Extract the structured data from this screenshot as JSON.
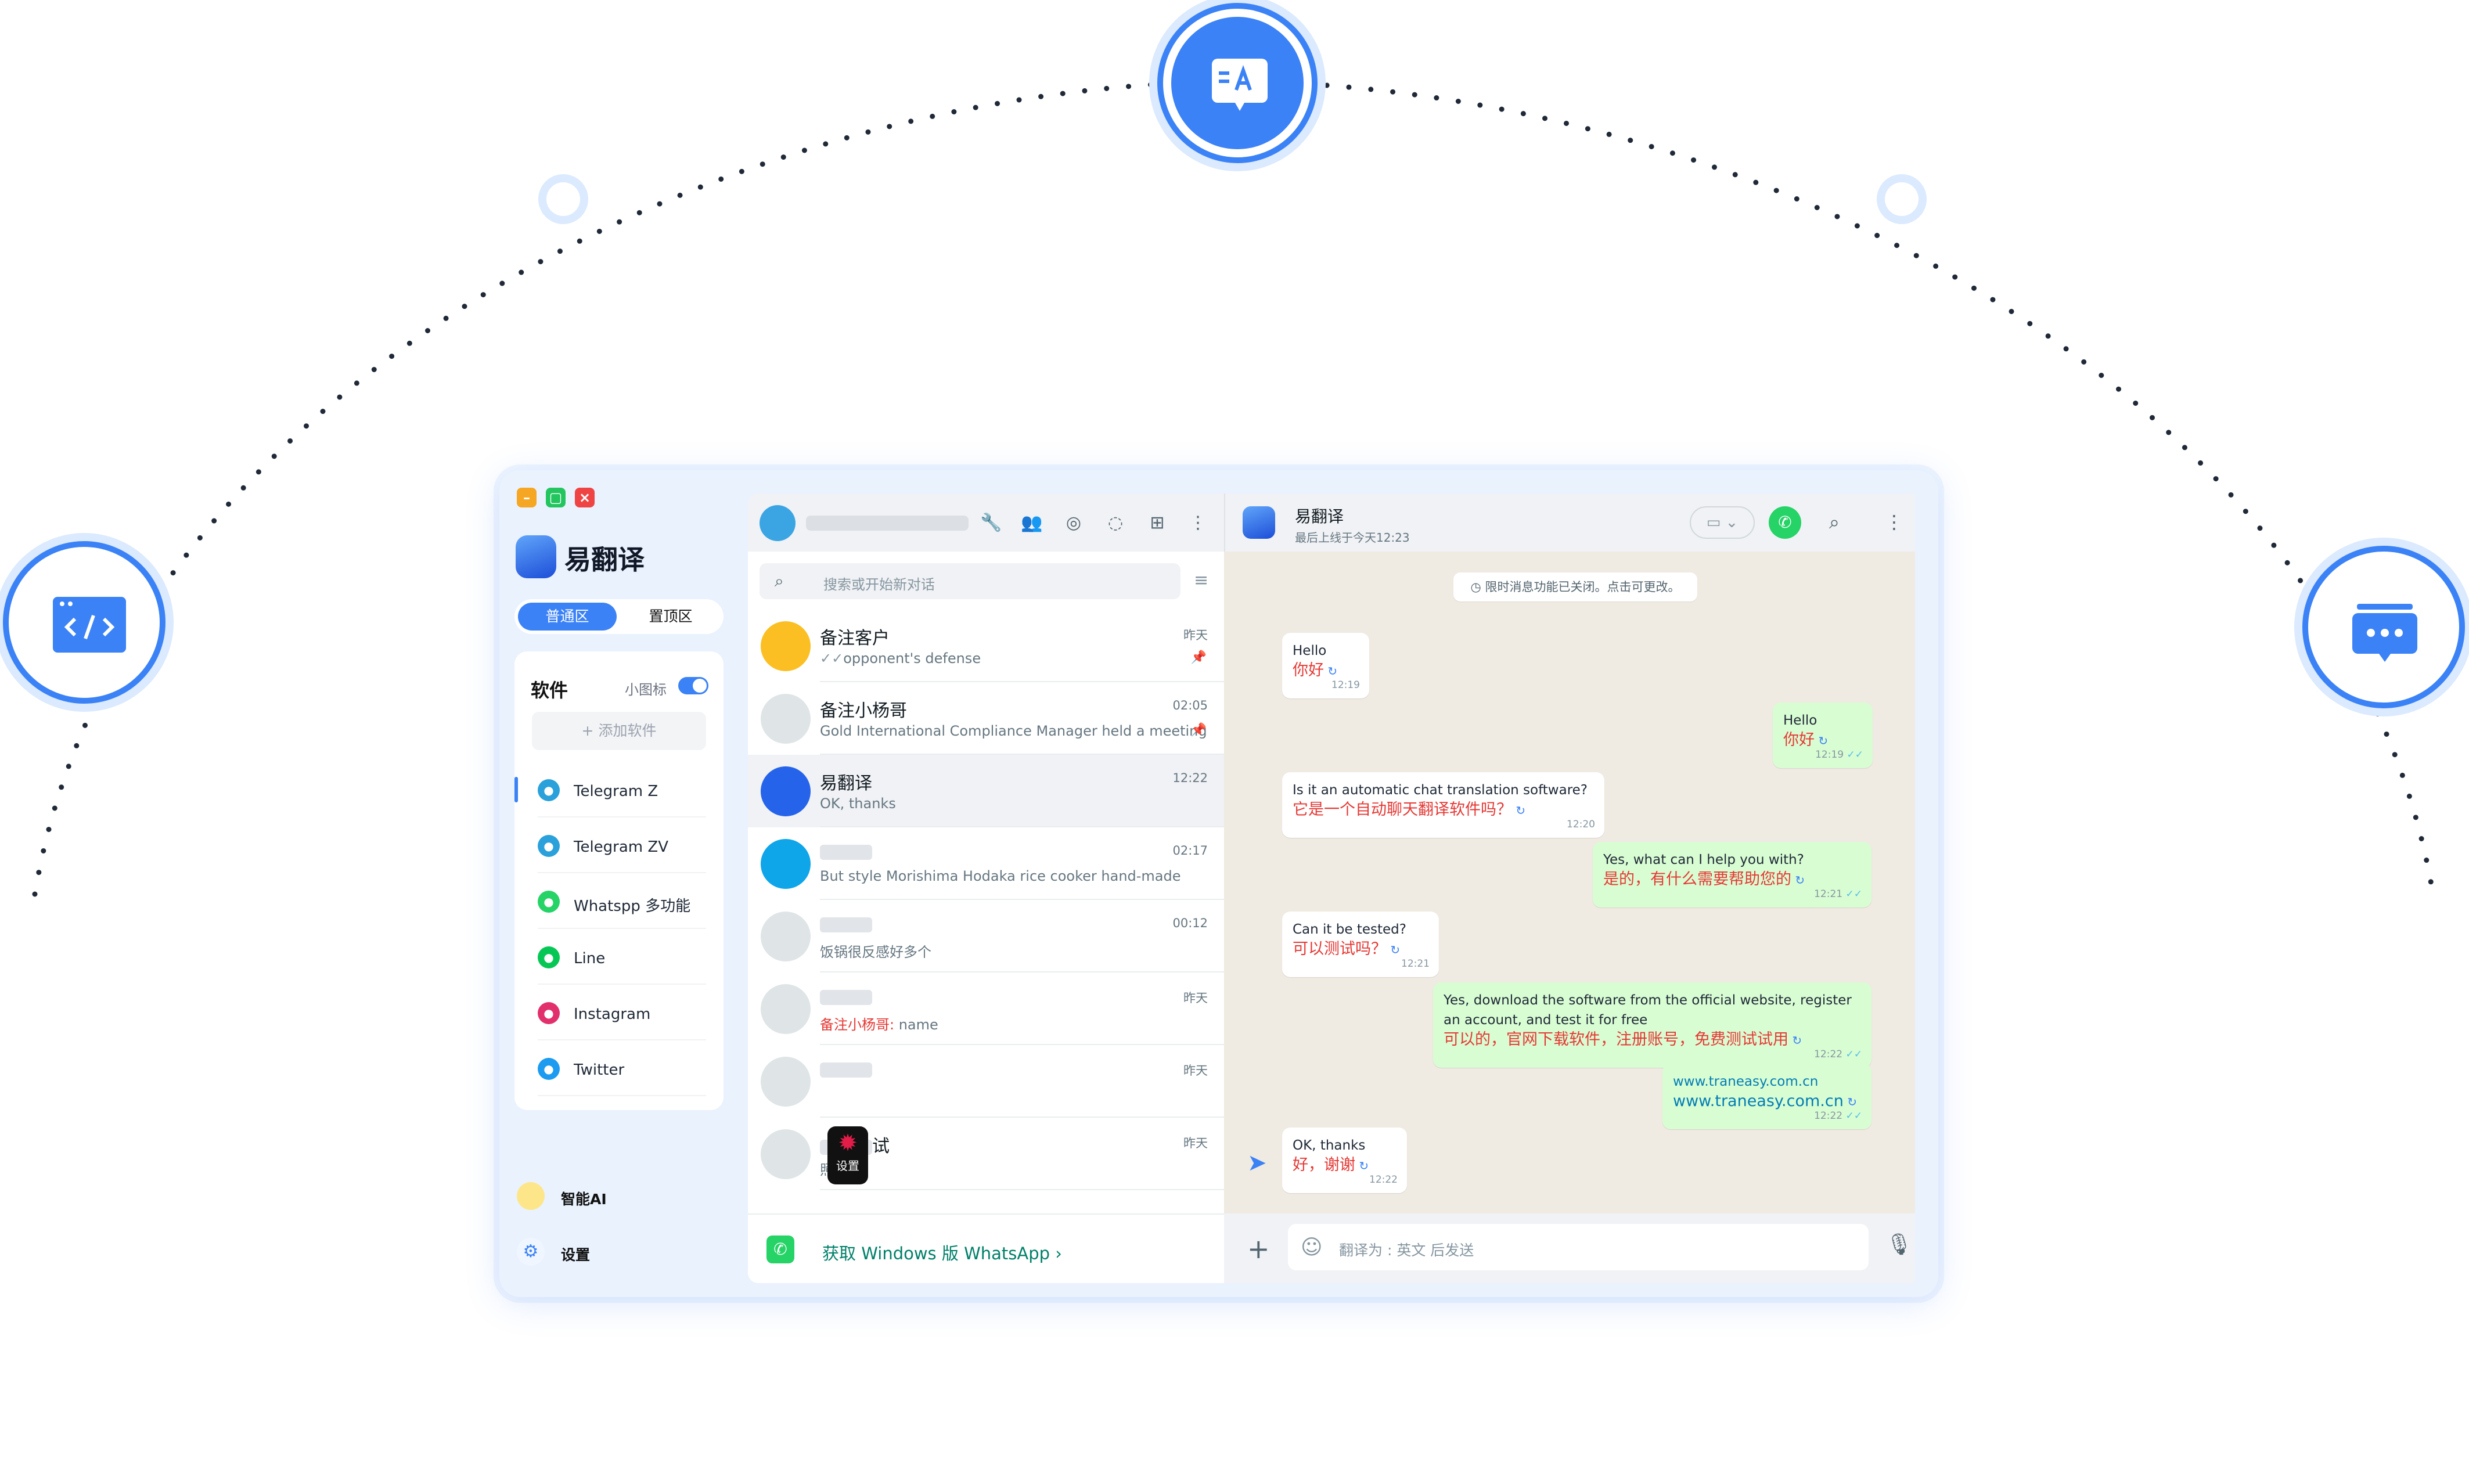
{
  "app": {
    "logo_text": "易翻译",
    "zone_tabs": [
      "普通区",
      "置顶区"
    ],
    "software_title": "软件",
    "small_icon_label": "小图标",
    "add_software": "+ 添加软件",
    "software": [
      {
        "label": "Telegram Z",
        "icon": "telegram-icon",
        "color": "#2aa1da"
      },
      {
        "label": "Telegram ZV",
        "icon": "telegram-icon",
        "color": "#2aa1da"
      },
      {
        "label": "Whatspp 多功能",
        "icon": "whatsapp-icon",
        "color": "#25d366"
      },
      {
        "label": "Line",
        "icon": "line-icon",
        "color": "#06c755"
      },
      {
        "label": "Instagram",
        "icon": "instagram-icon",
        "color": "#e1306c"
      },
      {
        "label": "Twitter",
        "icon": "twitter-icon",
        "color": "#1d9bf0"
      }
    ],
    "bottom": {
      "ai_label": "智能AI",
      "settings_label": "设置"
    }
  },
  "chatlist": {
    "search_placeholder": "搜索或开始新对话",
    "chats": [
      {
        "name": "备注客户",
        "preview": "opponent's defense",
        "time": "昨天",
        "name_red": true,
        "pinned": true,
        "checks": "✓✓"
      },
      {
        "name": "备注小杨哥",
        "preview": "Gold International Compliance Manager held a meeting",
        "time": "02:05",
        "name_red": true,
        "pinned": true
      },
      {
        "name": "易翻译",
        "preview": "OK, thanks",
        "time": "12:22"
      },
      {
        "name": "",
        "preview": "But style Morishima Hodaka rice cooker hand-made",
        "time": "02:17"
      },
      {
        "name": "",
        "preview": "饭锅很反感好多个",
        "time": "00:12"
      },
      {
        "name": "",
        "preview_prefix": "备注小杨哥:",
        "preview": " name",
        "time": "昨天"
      },
      {
        "name": "",
        "preview": "",
        "time": "昨天"
      },
      {
        "name": "试",
        "preview": "照片",
        "time": "昨天"
      }
    ],
    "get_whatsapp": "获取 Windows 版 WhatsApp ›",
    "settings_badge": "设置"
  },
  "conversation": {
    "name": "易翻译",
    "status": "最后上线于今天12:23",
    "notice": "◷ 限时消息功能已关闭。点击可更改。",
    "messages": [
      {
        "dir": "in",
        "text": "Hello",
        "translation": "你好",
        "time": "12:19"
      },
      {
        "dir": "out",
        "text": "Hello",
        "translation": "你好",
        "time": "12:19"
      },
      {
        "dir": "in",
        "text": "Is it an automatic chat translation software?",
        "translation": "它是一个自动聊天翻译软件吗？",
        "time": "12:20"
      },
      {
        "dir": "out",
        "text": "Yes, what can I help you with?",
        "translation": "是的，有什么需要帮助您的",
        "time": "12:21"
      },
      {
        "dir": "in",
        "text": "Can it be tested?",
        "translation": "可以测试吗？",
        "time": "12:21"
      },
      {
        "dir": "out",
        "text": "Yes, download the software from the official website, register an account, and test it for free",
        "translation": "可以的，官网下载软件，注册账号，免费测试试用",
        "time": "12:22"
      },
      {
        "dir": "out",
        "text": "www.traneasy.com.cn",
        "translation": "www.traneasy.com.cn",
        "time": "12:22",
        "link": true
      },
      {
        "dir": "in",
        "text": "OK, thanks",
        "translation": "好，谢谢",
        "time": "12:22"
      }
    ],
    "input_placeholder": "翻译为 : 英文 后发送"
  },
  "colors": {
    "accent": "#3b82f6",
    "whatsapp_green": "#25d366",
    "translation_red": "#e53935"
  }
}
